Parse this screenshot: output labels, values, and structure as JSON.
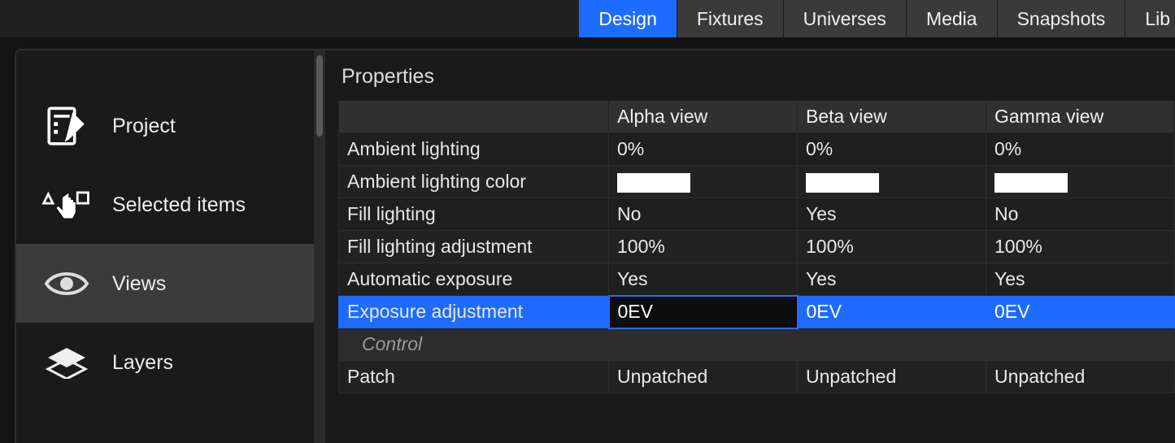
{
  "tabs": {
    "items": [
      "Design",
      "Fixtures",
      "Universes",
      "Media",
      "Snapshots",
      "Lib"
    ],
    "active_index": 0
  },
  "sidebar": {
    "items": [
      {
        "label": "Project"
      },
      {
        "label": "Selected items"
      },
      {
        "label": "Views"
      },
      {
        "label": "Layers"
      }
    ],
    "active_index": 2
  },
  "content": {
    "section_title": "Properties",
    "columns": [
      "",
      "Alpha view",
      "Beta view",
      "Gamma view"
    ],
    "rows": [
      {
        "label": "Ambient lighting",
        "values": [
          "0%",
          "0%",
          "0%"
        ]
      },
      {
        "label": "Ambient lighting color",
        "values": [
          "#ffffff",
          "#ffffff",
          "#ffffff"
        ],
        "type": "color"
      },
      {
        "label": "Fill lighting",
        "values": [
          "No",
          "Yes",
          "No"
        ]
      },
      {
        "label": "Fill lighting adjustment",
        "values": [
          "100%",
          "100%",
          "100%"
        ]
      },
      {
        "label": "Automatic exposure",
        "values": [
          "Yes",
          "Yes",
          "Yes"
        ]
      },
      {
        "label": "Exposure adjustment",
        "values": [
          "0EV",
          "0EV",
          "0EV"
        ],
        "selected": true,
        "editing_col": 0
      },
      {
        "label": "Control",
        "group": true
      },
      {
        "label": "Patch",
        "values": [
          "Unpatched",
          "Unpatched",
          "Unpatched"
        ]
      }
    ]
  }
}
